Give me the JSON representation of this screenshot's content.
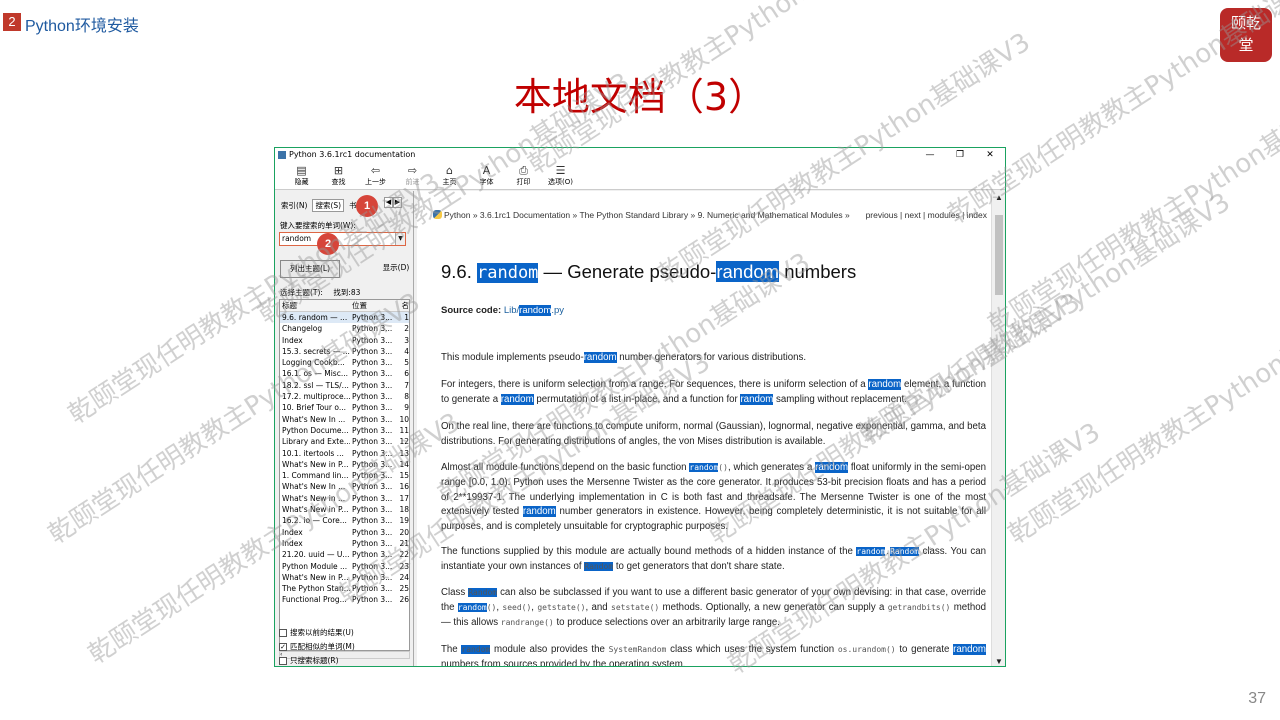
{
  "slide": {
    "section_number": "2",
    "section_title": "Python环境安装",
    "title": "本地文档（3）",
    "page_number": "37",
    "seal_text": "颐乾\n堂",
    "watermark": "乾颐堂现任明教教主Python基础课V3"
  },
  "window": {
    "title": "Python 3.6.1rc1 documentation",
    "controls": [
      "—",
      "❐",
      "✕"
    ],
    "toolbar": [
      {
        "icon": "hide-icon",
        "glyph": "▤",
        "label": "隐藏",
        "enabled": true
      },
      {
        "icon": "locate-icon",
        "glyph": "⊞",
        "label": "查找",
        "enabled": true
      },
      {
        "icon": "back-icon",
        "glyph": "⇦",
        "label": "上一步",
        "enabled": true
      },
      {
        "icon": "forward-icon",
        "glyph": "⇨",
        "label": "前进",
        "enabled": false
      },
      {
        "icon": "home-icon",
        "glyph": "⌂",
        "label": "主页",
        "enabled": true
      },
      {
        "icon": "font-icon",
        "glyph": "A",
        "label": "字体",
        "enabled": true
      },
      {
        "icon": "print-icon",
        "glyph": "⎙",
        "label": "打印",
        "enabled": true
      },
      {
        "icon": "options-icon",
        "glyph": "☰",
        "label": "选项(O)",
        "enabled": true
      }
    ]
  },
  "left_panel": {
    "tabs": [
      "索引(N)",
      "搜索(S)",
      "书"
    ],
    "active_tab": "搜索(S)",
    "keyword_label": "键入要搜索的单词(W):",
    "keyword_value": "random",
    "list_topics_button": "列出主题(L)",
    "display_button": "显示(D)",
    "select_topic_label": "选择主题(T):",
    "found_label": "找到:83",
    "columns": [
      "标题",
      "位置",
      "名"
    ],
    "rows": [
      [
        "9.6. random — ...",
        "Python 3...",
        "1"
      ],
      [
        "Changelog",
        "Python 3...",
        "2"
      ],
      [
        "Index",
        "Python 3...",
        "3"
      ],
      [
        "15.3. secrets — ...",
        "Python 3...",
        "4"
      ],
      [
        "Logging Cookb...",
        "Python 3...",
        "5"
      ],
      [
        "16.1. os — Misc...",
        "Python 3...",
        "6"
      ],
      [
        "18.2. ssl — TLS/...",
        "Python 3...",
        "7"
      ],
      [
        "17.2. multiproce...",
        "Python 3...",
        "8"
      ],
      [
        "10. Brief Tour o...",
        "Python 3...",
        "9"
      ],
      [
        "What's New In ...",
        "Python 3...",
        "10"
      ],
      [
        "Python Docume...",
        "Python 3...",
        "11"
      ],
      [
        "Library and Exte...",
        "Python 3...",
        "12"
      ],
      [
        "10.1. itertools ...",
        "Python 3...",
        "13"
      ],
      [
        "What's New in P...",
        "Python 3...",
        "14"
      ],
      [
        "1. Command lin...",
        "Python 3...",
        "15"
      ],
      [
        "What's New In ...",
        "Python 3...",
        "16"
      ],
      [
        "What's New in ...",
        "Python 3...",
        "17"
      ],
      [
        "What's New in P...",
        "Python 3...",
        "18"
      ],
      [
        "16.2. io — Core...",
        "Python 3...",
        "19"
      ],
      [
        "Index",
        "Python 3...",
        "20"
      ],
      [
        "Index",
        "Python 3...",
        "21"
      ],
      [
        "21.20. uuid — U...",
        "Python 3...",
        "22"
      ],
      [
        "Python Module ...",
        "Python 3...",
        "23"
      ],
      [
        "What's New in P...",
        "Python 3...",
        "24"
      ],
      [
        "The Python Stan...",
        "Python 3...",
        "25"
      ],
      [
        "Functional Prog...",
        "Python 3...",
        "26"
      ]
    ],
    "checkboxes": [
      {
        "label": "搜索以前的结果(U)",
        "checked": false
      },
      {
        "label": "匹配相似的单词(M)",
        "checked": true
      },
      {
        "label": "只搜索标题(R)",
        "checked": false
      }
    ],
    "badges": [
      "1",
      "2"
    ]
  },
  "content": {
    "breadcrumb": "Python » 3.6.1rc1 Documentation » The Python Standard Library » 9. Numeric and Mathematical Modules »",
    "nav_links": "previous | next | modules | index",
    "heading_number": "9.6.",
    "heading_keyword": "random",
    "heading_middle": " — Generate pseudo-",
    "heading_keyword2": "random",
    "heading_end": " numbers",
    "source_label": "Source code:",
    "source_link_pre": "Lib/",
    "source_link_kw": "random",
    "source_link_post": ".py"
  }
}
